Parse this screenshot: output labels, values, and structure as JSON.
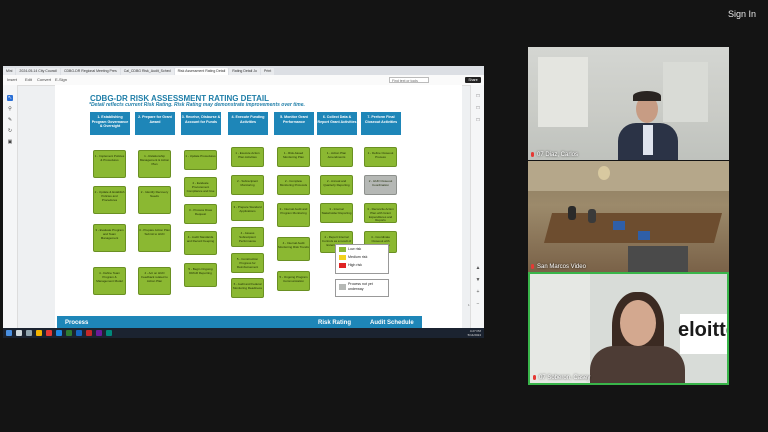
{
  "top": {
    "sign_in": "Sign In"
  },
  "browser": {
    "tabs": [
      "Mini",
      "2024-05-14 City Council",
      "CDBG-DR Regional Meeting Pres",
      "Cal_CDBG Risk_Audit_Sched",
      "Risk Assessment Rating Detail",
      "Rating Detail Jo",
      "Print"
    ],
    "menu": [
      "Insert",
      "Edit",
      "Convert",
      "E-Sign"
    ],
    "search_placeholder": "Find text or tools",
    "share_button": "Share"
  },
  "slide": {
    "title": "CDBG-DR RISK ASSESSMENT RATING DETAIL",
    "subtitle": "*Detail reflects current Risk Rating. Risk Rating may demonstrate improvements over time.",
    "columns": [
      {
        "header": "1. Establishing Program Governance & Oversight",
        "items": [
          "1 - Implement Policies & Procedures",
          "2 - Update & Establish Policies and Procedures",
          "3 - Evaluate Program and Team Management",
          "4 - Define Team Program & Management Model"
        ]
      },
      {
        "header": "2. Prepare for Grant Award",
        "items": [
          "1 - Relationship Management & Action Plan",
          "2 - Identify Recovery Needs",
          "3 - Prepare Action Plan Submit to HUD",
          "4 - Act on HUD Feedback related to Action Plan"
        ]
      },
      {
        "header": "3. Receive, Disburse & Account for Funds",
        "items": [
          "1 - Update Procedures",
          "2 - Evaluate Procurement Compliance and Use",
          "3 - Process Draw Request",
          "4 - Audit Standards and Record Keeping",
          "5 - Begin Ongoing DRGR Reporting"
        ]
      },
      {
        "header": "4. Execute Funding Activities",
        "items": [
          "1 - Execute Action Plan Activities",
          "2 - Subrecipient Monitoring",
          "3 - Prepare Standard Applications",
          "4 - Assess Subrecipient Performance",
          "5 - Construction Progress for Reimbursement",
          "6 - Audit and Federal Monitoring Readiness"
        ]
      },
      {
        "header": "5. Monitor Grant Performance",
        "items": [
          "1 - Risk-based Monitoring Plan",
          "2 - Complete Monitoring Protocols",
          "3 - Internal Audit and Program Monitoring",
          "4 - Internal Audit Monitoring Risk Trends",
          "5 - Ongoing Program Communication"
        ]
      },
      {
        "header": "6. Collect Data & Report Grant Activities",
        "items": [
          "1 - Action Plan Amendments",
          "2 - Annual and Quarterly Reporting",
          "3 - Internal Stakeholder Reporting",
          "4 - Report Internal Controls as a result of External Audits"
        ]
      },
      {
        "header": "7. Perform Final Closeout Activities",
        "items": [
          "1 - Define Closeout Process",
          "2 - HUD Closeout Coordination",
          "3 - Reconcile Action Plan with Grant Expenditures and Reports",
          "4 - Coordinate Closeout with Subrecipients"
        ]
      }
    ],
    "legend": [
      {
        "label": "Low risk",
        "color": "#8bb832"
      },
      {
        "label": "Medium risk",
        "color": "#f2d21b"
      },
      {
        "label": "High risk",
        "color": "#e02424"
      }
    ],
    "legend_process": "Process not yet underway",
    "footer": {
      "left": "Process",
      "middle": "Risk Rating",
      "right": "Audit Schedule"
    }
  },
  "taskbar": {
    "time": "4:27 PM",
    "date": "5/14/2024"
  },
  "participants": [
    {
      "name": "07 Diaz, Carlos"
    },
    {
      "name": "San Marcos Video"
    },
    {
      "name": "07 Soberon, Casey"
    }
  ]
}
